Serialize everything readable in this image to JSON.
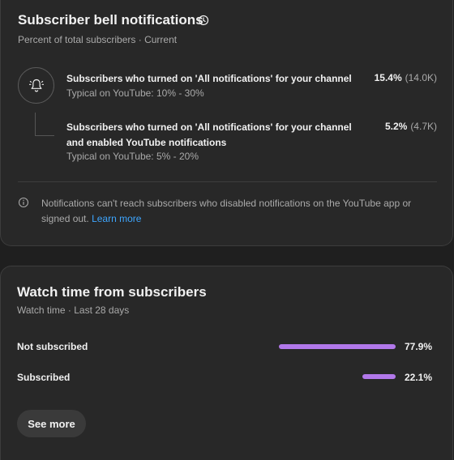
{
  "bell": {
    "title": "Subscriber bell notifications",
    "subtitle": "Percent of total subscribers · Current",
    "rows": [
      {
        "label": "Subscribers who turned on 'All notifications' for your channel",
        "typical": "Typical on YouTube: 10% - 30%",
        "percent": "15.4%",
        "count": "(14.0K)"
      },
      {
        "label": "Subscribers who turned on 'All notifications' for your channel and enabled YouTube notifications",
        "typical": "Typical on YouTube: 5% - 20%",
        "percent": "5.2%",
        "count": "(4.7K)"
      }
    ],
    "info_text": "Notifications can't reach subscribers who disabled notifications on the YouTube app or signed out.",
    "learn_more": "Learn more"
  },
  "watch_time": {
    "title": "Watch time from subscribers",
    "subtitle": "Watch time · Last 28 days",
    "rows": [
      {
        "label": "Not subscribed",
        "percent": "77.9%",
        "value": 77.9
      },
      {
        "label": "Subscribed",
        "percent": "22.1%",
        "value": 22.1
      }
    ],
    "bar_color": "#b278ea",
    "see_more": "See more"
  },
  "icons": {
    "history": "clock-history-icon",
    "bell": "bell-icon",
    "info": "info-icon"
  }
}
